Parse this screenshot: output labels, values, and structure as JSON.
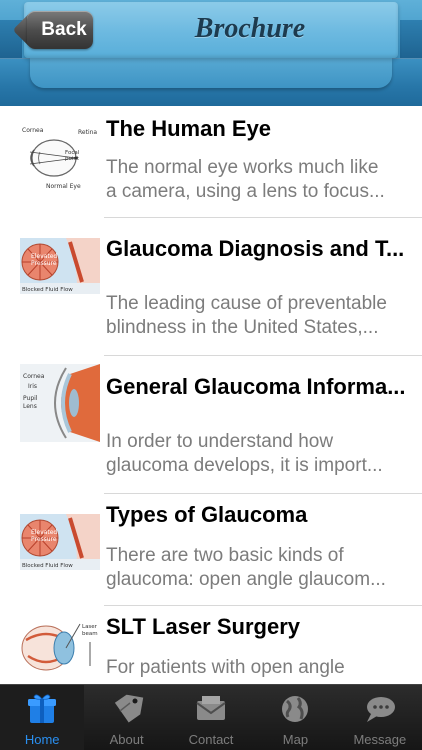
{
  "header": {
    "back_label": "Back",
    "title": "Brochure"
  },
  "items": [
    {
      "title": "The Human Eye",
      "desc_line1": "The normal eye works much like",
      "desc_line2": "a camera, using a lens to focus...",
      "thumb_icon": "normal-eye-diagram",
      "thumb_labels": [
        "Cornea",
        "Retina",
        "Focal",
        "point",
        "Normal Eye"
      ]
    },
    {
      "title": "Glaucoma Diagnosis and T...",
      "desc_line1": "The leading cause of preventable",
      "desc_line2": "blindness in the United States,...",
      "thumb_icon": "elevated-pressure-diagram",
      "thumb_labels": [
        "Elevated",
        "Pressure",
        "Blocked Fluid Flow"
      ]
    },
    {
      "title": "General Glaucoma Informa...",
      "desc_line1": "In order to understand how",
      "desc_line2": "glaucoma develops, it is import...",
      "thumb_icon": "eye-cross-section-diagram",
      "thumb_labels": [
        "Cornea",
        "Iris",
        "Pupil",
        "Lens"
      ]
    },
    {
      "title": "Types of Glaucoma",
      "desc_line1": "There are two basic kinds of",
      "desc_line2": "glaucoma: open angle glaucom...",
      "thumb_icon": "elevated-pressure-diagram",
      "thumb_labels": [
        "Elevated",
        "Pressure",
        "Blocked Fluid Flow"
      ]
    },
    {
      "title": "SLT Laser Surgery",
      "desc_line1": "For patients with open angle",
      "desc_line2": "",
      "thumb_icon": "laser-eye-diagram",
      "thumb_labels": [
        "Laser",
        "beam"
      ]
    }
  ],
  "tabs": [
    {
      "label": "Home",
      "icon": "home-box-icon",
      "active": true
    },
    {
      "label": "About",
      "icon": "tag-icon",
      "active": false
    },
    {
      "label": "Contact",
      "icon": "envelope-icon",
      "active": false
    },
    {
      "label": "Map",
      "icon": "globe-icon",
      "active": false
    },
    {
      "label": "Message",
      "icon": "chat-bubble-icon",
      "active": false
    }
  ],
  "colors": {
    "header_blue": "#3f96c6",
    "tab_active": "#2a8ff0",
    "tab_inactive": "#7d7d7d",
    "title_text": "#1d3b4f"
  }
}
